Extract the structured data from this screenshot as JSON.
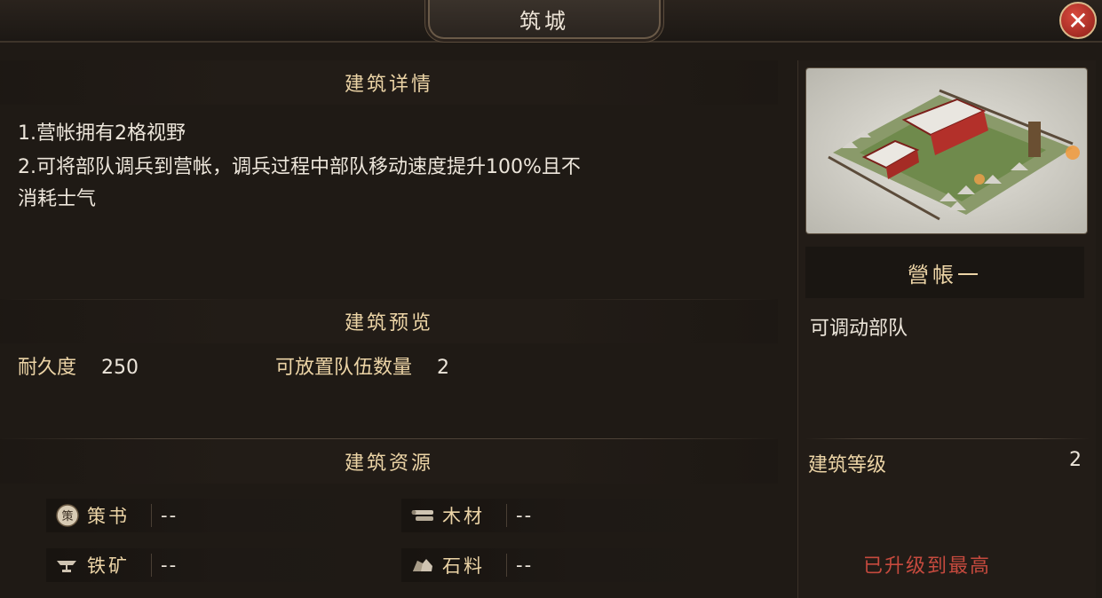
{
  "window": {
    "title": "筑城",
    "close_label": "✕"
  },
  "details": {
    "header": "建筑详情",
    "lines": [
      "1.营帐拥有2格视野",
      "2.可将部队调兵到营帐，调兵过程中部队移动速度提升100%且不",
      "消耗士气"
    ]
  },
  "preview": {
    "header": "建筑预览",
    "durability_label": "耐久度",
    "durability_value": "250",
    "troops_label": "可放置队伍数量",
    "troops_value": "2"
  },
  "resources": {
    "header": "建筑资源",
    "items": [
      {
        "name": "策书",
        "value": "--",
        "icon": "book-icon"
      },
      {
        "name": "木材",
        "value": "--",
        "icon": "wood-icon"
      },
      {
        "name": "铁矿",
        "value": "--",
        "icon": "iron-icon"
      },
      {
        "name": "石料",
        "value": "--",
        "icon": "stone-icon"
      }
    ]
  },
  "building": {
    "name": "營帳一",
    "function": "可调动部队",
    "level_label": "建筑等级",
    "level_value": "2",
    "status": "已升级到最高",
    "image_icon": "camp-illustration"
  },
  "colors": {
    "accent": "#ecd4a6",
    "status": "#c64a3e",
    "close": "#b52a22"
  }
}
